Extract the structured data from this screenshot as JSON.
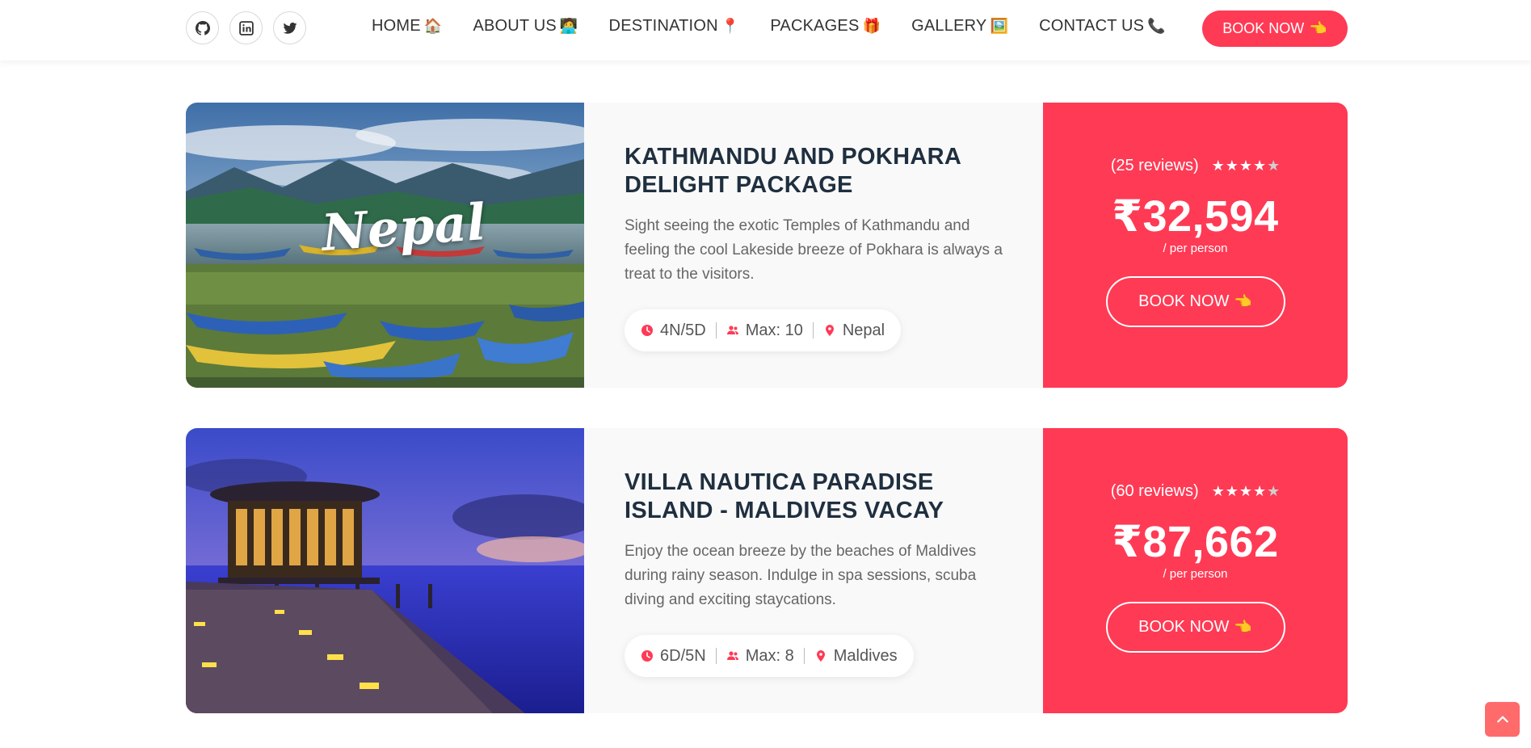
{
  "navbar": {
    "social": [
      {
        "icon": "github-icon"
      },
      {
        "icon": "linkedin-icon"
      },
      {
        "icon": "twitter-icon"
      }
    ],
    "links": [
      {
        "label": "HOME",
        "emoji": "🏠"
      },
      {
        "label": "ABOUT US",
        "emoji": "🧑‍💻"
      },
      {
        "label": "DESTINATION",
        "emoji": "📍"
      },
      {
        "label": "PACKAGES",
        "emoji": "🎁"
      },
      {
        "label": "GALLERY",
        "emoji": "🖼️"
      },
      {
        "label": "CONTACT US",
        "emoji": "📞"
      }
    ],
    "book_label": "BOOK NOW",
    "book_emoji": "👈"
  },
  "packages": [
    {
      "image_text": "Nepal",
      "title": "KATHMANDU AND POKHARA DELIGHT PACKAGE",
      "description": "Sight seeing the exotic Temples of Kathmandu and feeling the cool Lakeside breeze of Pokhara is always a treat to the visitors.",
      "duration": "4N/5D",
      "max": "Max: 10",
      "location": "Nepal",
      "reviews": "(25 reviews)",
      "rating": 4,
      "price": "₹32,594",
      "per": "/ per person",
      "book_label": "BOOK NOW",
      "book_emoji": "👈"
    },
    {
      "title": "VILLA NAUTICA PARADISE ISLAND - MALDIVES VACAY",
      "description": "Enjoy the ocean breeze by the beaches of Maldives during rainy season. Indulge in spa sessions, scuba diving and exciting staycations.",
      "duration": "6D/5N",
      "max": "Max: 8",
      "location": "Maldives",
      "reviews": "(60 reviews)",
      "rating": 4,
      "price": "₹87,662",
      "per": "/ per person",
      "book_label": "BOOK NOW",
      "book_emoji": "👈"
    }
  ],
  "colors": {
    "accent": "#ff3a55",
    "title": "#1f2f3f",
    "card_bg": "#f9f9f9",
    "scroll_top": "#ff6b6b"
  }
}
